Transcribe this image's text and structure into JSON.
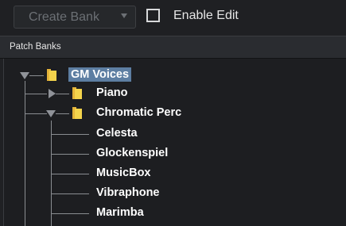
{
  "toolbar": {
    "create_bank_label": "Create Bank",
    "enable_edit_label": "Enable Edit",
    "enable_edit_checked": false
  },
  "panel": {
    "title": "Patch Banks"
  },
  "tree": {
    "root": {
      "label": "GM Voices",
      "expanded": true,
      "selected": true
    },
    "folders": [
      {
        "label": "Piano",
        "expanded": false
      },
      {
        "label": "Chromatic Perc",
        "expanded": true
      }
    ],
    "leaves": [
      "Celesta",
      "Glockenspiel",
      "MusicBox",
      "Vibraphone",
      "Marimba"
    ]
  },
  "colors": {
    "background": "#1d1e21",
    "selection": "#5d7ea2",
    "folder": "#f4d44c",
    "text": "#ffffff"
  }
}
